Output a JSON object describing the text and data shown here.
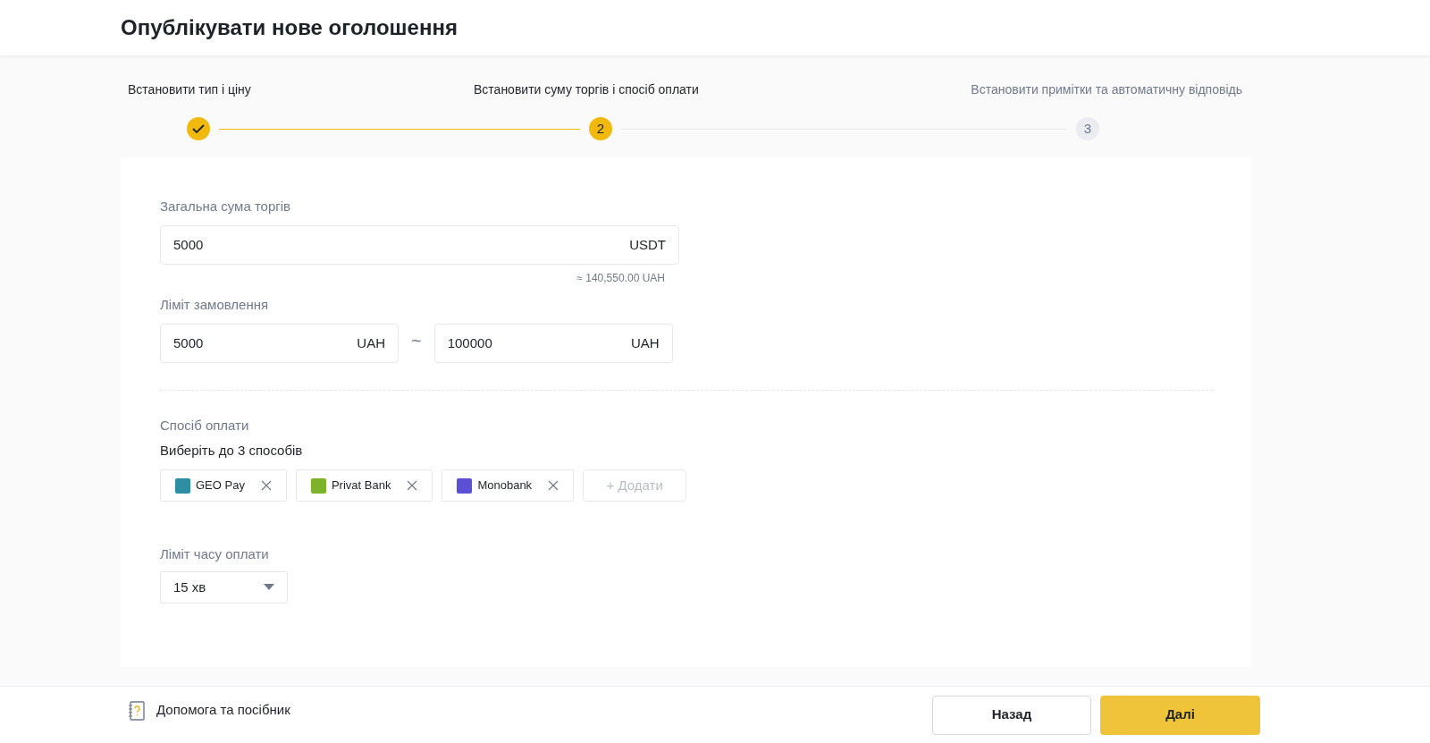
{
  "header": {
    "title": "Опублікувати нове оголошення"
  },
  "steps": [
    {
      "label": "Встановити тип і ціну",
      "kind": "done"
    },
    {
      "label": "Встановити суму торгів і спосіб оплати",
      "number": "2",
      "kind": "active"
    },
    {
      "label": "Встановити примітки та автоматичну відповідь",
      "number": "3",
      "kind": "pending"
    }
  ],
  "total": {
    "label": "Загальна сума торгів",
    "value": "5000",
    "unit": "USDT",
    "equivalent": "≈ 140,550.00 UAH"
  },
  "order_limit": {
    "label": "Ліміт замовлення",
    "min": {
      "value": "5000",
      "unit": "UAH"
    },
    "separator": "~",
    "max": {
      "value": "100000",
      "unit": "UAH"
    }
  },
  "payment": {
    "label": "Спосіб оплати",
    "hint": "Виберіть до 3 способів",
    "methods": [
      {
        "name": "GEO Pay",
        "color": "#2e8fa3"
      },
      {
        "name": "Privat Bank",
        "color": "#7cb32a"
      },
      {
        "name": "Monobank",
        "color": "#5b4fd6"
      }
    ],
    "add_button": "+ Додати"
  },
  "time_limit": {
    "label": "Ліміт часу оплати",
    "value": "15 хв"
  },
  "footer": {
    "help": "Допомога та посібник",
    "back": "Назад",
    "next": "Далі"
  }
}
